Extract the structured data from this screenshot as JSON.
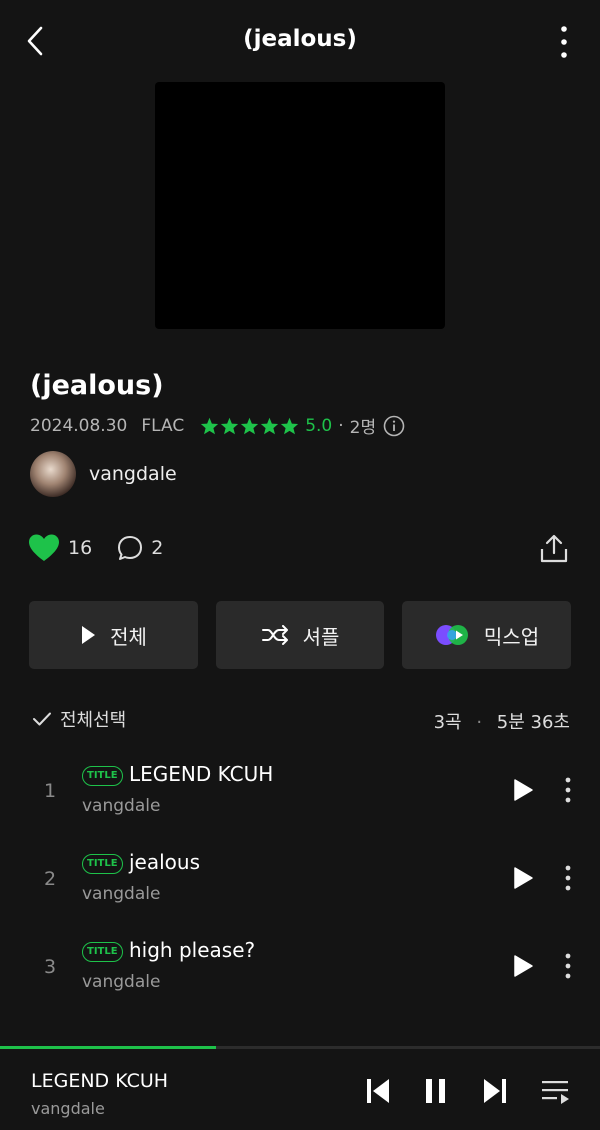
{
  "header": {
    "title": "(jealous)"
  },
  "album": {
    "title": "(jealous)",
    "date": "2024.08.30",
    "format": "FLAC",
    "rating": "5.0",
    "rating_count": "2명",
    "stars": 5,
    "artist": "vangdale"
  },
  "social": {
    "likes": "16",
    "comments": "2"
  },
  "actions": {
    "play_all": "전체",
    "shuffle": "셔플",
    "mixup": "믹스업"
  },
  "list": {
    "select_all": "전체선택",
    "track_count": "3곡",
    "duration": "5분 36초",
    "separator": "·"
  },
  "badge_label": "TITLE",
  "tracks": [
    {
      "num": "1",
      "title": "LEGEND KCUH",
      "artist": "vangdale"
    },
    {
      "num": "2",
      "title": "jealous",
      "artist": "vangdale"
    },
    {
      "num": "3",
      "title": "high please?",
      "artist": "vangdale"
    }
  ],
  "player": {
    "title": "LEGEND KCUH",
    "artist": "vangdale",
    "progress": 0.36
  },
  "colors": {
    "accent": "#1ec24a",
    "background": "#141414",
    "button": "#2a2a2a"
  }
}
